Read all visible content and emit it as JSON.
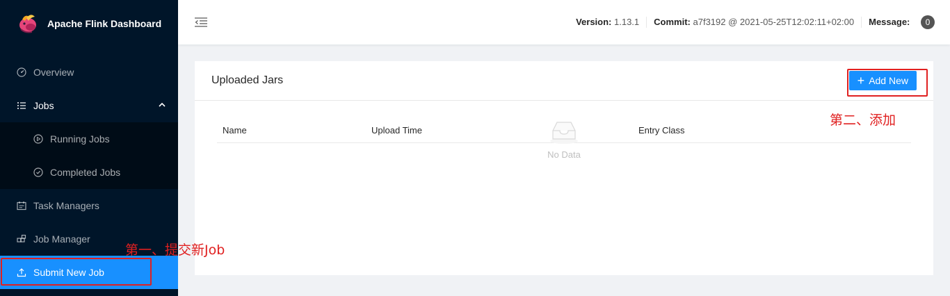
{
  "app": {
    "title": "Apache Flink Dashboard"
  },
  "sidebar": {
    "items": [
      {
        "label": "Overview",
        "icon": "dashboard-icon"
      },
      {
        "label": "Jobs",
        "icon": "list-icon",
        "expanded": true
      },
      {
        "label": "Running Jobs",
        "icon": "play-circle-icon"
      },
      {
        "label": "Completed Jobs",
        "icon": "check-circle-icon"
      },
      {
        "label": "Task Managers",
        "icon": "schedule-icon"
      },
      {
        "label": "Job Manager",
        "icon": "build-icon"
      },
      {
        "label": "Submit New Job",
        "icon": "upload-icon",
        "selected": true
      }
    ]
  },
  "header": {
    "version_label": "Version:",
    "version_value": "1.13.1",
    "commit_label": "Commit:",
    "commit_value": "a7f3192 @ 2021-05-25T12:02:11+02:00",
    "message_label": "Message:",
    "message_count": "0"
  },
  "card": {
    "title": "Uploaded Jars",
    "add_button": "Add New",
    "columns": [
      "Name",
      "Upload Time",
      "Entry Class"
    ],
    "empty_text": "No Data"
  },
  "annotations": {
    "step1": "第一、提交新Job",
    "step2": "第二、添加"
  },
  "colors": {
    "sidebar_bg": "#001529",
    "submenu_bg": "#000c17",
    "primary": "#1890ff",
    "annotation": "#e02020"
  }
}
